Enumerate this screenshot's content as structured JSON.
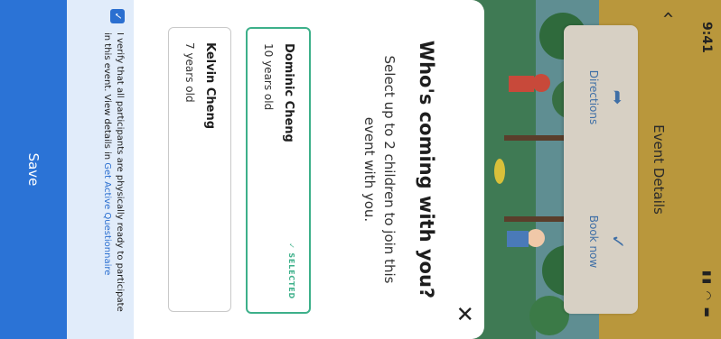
{
  "status_bar": {
    "time": "9:41",
    "icons": "..ll ◠ ▮"
  },
  "header": {
    "title": "Event Details"
  },
  "actions": {
    "directions_label": "Directions",
    "book_label": "Book now"
  },
  "sheet": {
    "title": "Who's coming with you?",
    "subtitle": "Select up to 2 children to join this event with you.",
    "children": [
      {
        "name": "Dominic Cheng",
        "age": "10 years old",
        "selected": true,
        "tag": "SELECTED"
      },
      {
        "name": "Kelvin Cheng",
        "age": "7 years old",
        "selected": false
      }
    ],
    "verify": {
      "text": "I verify that all participants are physically ready to participate in this event. View details in",
      "link": "Get Active Questionnaire",
      "checked": true
    },
    "save_label": "Save"
  },
  "colors": {
    "header_bg": "#b9973c",
    "selected": "#3db08a",
    "primary": "#2b73d6",
    "verify_bg": "#e1ecfa"
  }
}
